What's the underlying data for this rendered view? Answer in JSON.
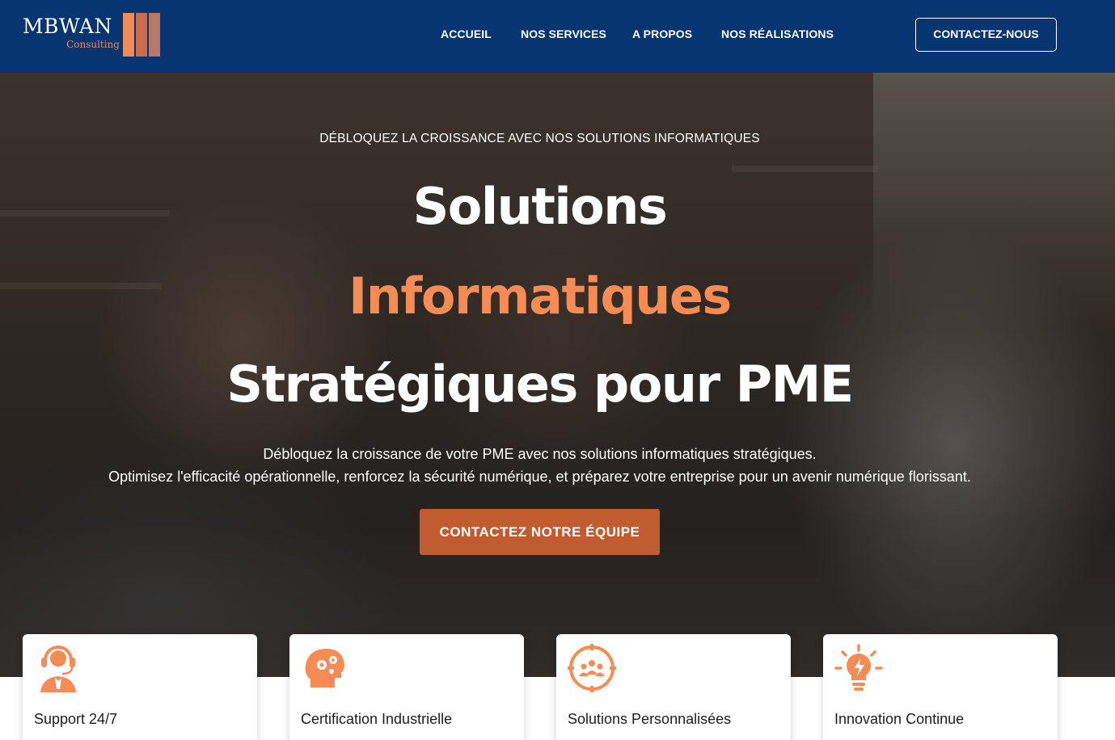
{
  "header": {
    "logo": {
      "name": "MBWAN",
      "tagline": "Consulting"
    },
    "nav": [
      {
        "label": "ACCUEIL"
      },
      {
        "label": "NOS SERVICES"
      },
      {
        "label": "A PROPOS"
      },
      {
        "label": "NOS RÉALISATIONS"
      }
    ],
    "cta_label": "CONTACTEZ-NOUS"
  },
  "hero": {
    "eyebrow": "DÉBLOQUEZ LA CROISSANCE AVEC NOS SOLUTIONS INFORMATIQUES",
    "title_line1": "Solutions",
    "title_line2": "Informatiques",
    "title_line3": "Stratégiques pour PME",
    "description_line1": "Débloquez la croissance de votre PME avec nos solutions informatiques stratégiques.",
    "description_line2": "Optimisez l'efficacité opérationnelle, renforcez la sécurité numérique, et préparez votre entreprise pour un avenir numérique florissant.",
    "cta_label": "CONTACTEZ NOTRE ÉQUIPE"
  },
  "features": [
    {
      "title": "Support 24/7",
      "icon": "headset-support-icon"
    },
    {
      "title": "Certification Industrielle",
      "icon": "head-gears-icon"
    },
    {
      "title": "Solutions Personnalisées",
      "icon": "target-team-icon"
    },
    {
      "title": "Innovation Continue",
      "icon": "lightbulb-idea-icon"
    }
  ],
  "colors": {
    "header_bg": "#073572",
    "accent": "#f58c55",
    "cta_bg": "#c15b30"
  }
}
